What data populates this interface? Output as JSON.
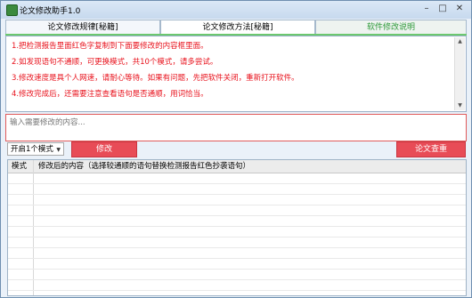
{
  "window": {
    "title": "论文修改助手1.0"
  },
  "tabs": [
    {
      "label": "论文修改规律[秘籍]"
    },
    {
      "label": "论文修改方法[秘籍]"
    },
    {
      "label": "软件修改说明"
    }
  ],
  "instructions": [
    "1.把检测报告里面红色字复制到下面要修改的内容框里面。",
    "2.如发现语句不通顺，可更换模式，共10个模式，请多尝试。",
    "3.修改速度是具个人网速，请耐心等待。如果有问题，先把软件关闭，重新打开软件。",
    "4.修改完成后，还需要注意查看语句是否通顺，用词恰当。"
  ],
  "input": {
    "placeholder": "输入需要修改的内容..."
  },
  "controls": {
    "mode_selected": "开启1个模式",
    "modify_button": "修改",
    "recheck_button": "论文查重"
  },
  "table": {
    "columns": [
      "模式",
      "修改后的内容（选择较通顺的语句替换检测报告红色抄袭语句）"
    ],
    "rows": []
  },
  "colors": {
    "accent_red": "#e84c57",
    "instruction_text": "#e8121c",
    "tab_highlight": "#2e9a3a"
  }
}
